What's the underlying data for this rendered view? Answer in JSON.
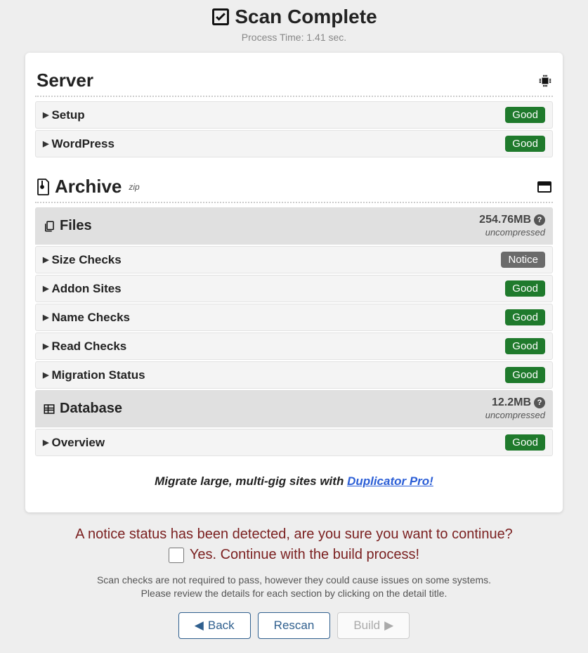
{
  "header": {
    "title": "Scan Complete",
    "subtitle": "Process Time: 1.41 sec."
  },
  "server": {
    "title": "Server",
    "rows": [
      {
        "label": "Setup",
        "status": "Good",
        "statusClass": "badge-good"
      },
      {
        "label": "WordPress",
        "status": "Good",
        "statusClass": "badge-good"
      }
    ]
  },
  "archive": {
    "title": "Archive",
    "format": "zip",
    "files": {
      "title": "Files",
      "size": "254.76MB",
      "note": "uncompressed",
      "rows": [
        {
          "label": "Size Checks",
          "status": "Notice",
          "statusClass": "badge-notice"
        },
        {
          "label": "Addon Sites",
          "status": "Good",
          "statusClass": "badge-good"
        },
        {
          "label": "Name Checks",
          "status": "Good",
          "statusClass": "badge-good"
        },
        {
          "label": "Read Checks",
          "status": "Good",
          "statusClass": "badge-good"
        },
        {
          "label": "Migration Status",
          "status": "Good",
          "statusClass": "badge-good"
        }
      ]
    },
    "database": {
      "title": "Database",
      "size": "12.2MB",
      "note": "uncompressed",
      "rows": [
        {
          "label": "Overview",
          "status": "Good",
          "statusClass": "badge-good"
        }
      ]
    }
  },
  "promo": {
    "text": "Migrate large, multi-gig sites with ",
    "linkText": "Duplicator Pro!"
  },
  "footer": {
    "warn": "A notice status has been detected, are you sure you want to continue?",
    "confirm": "Yes. Continue with the build process!",
    "small1": "Scan checks are not required to pass, however they could cause issues on some systems.",
    "small2": "Please review the details for each section by clicking on the detail title.",
    "back": "Back",
    "rescan": "Rescan",
    "build": "Build"
  }
}
